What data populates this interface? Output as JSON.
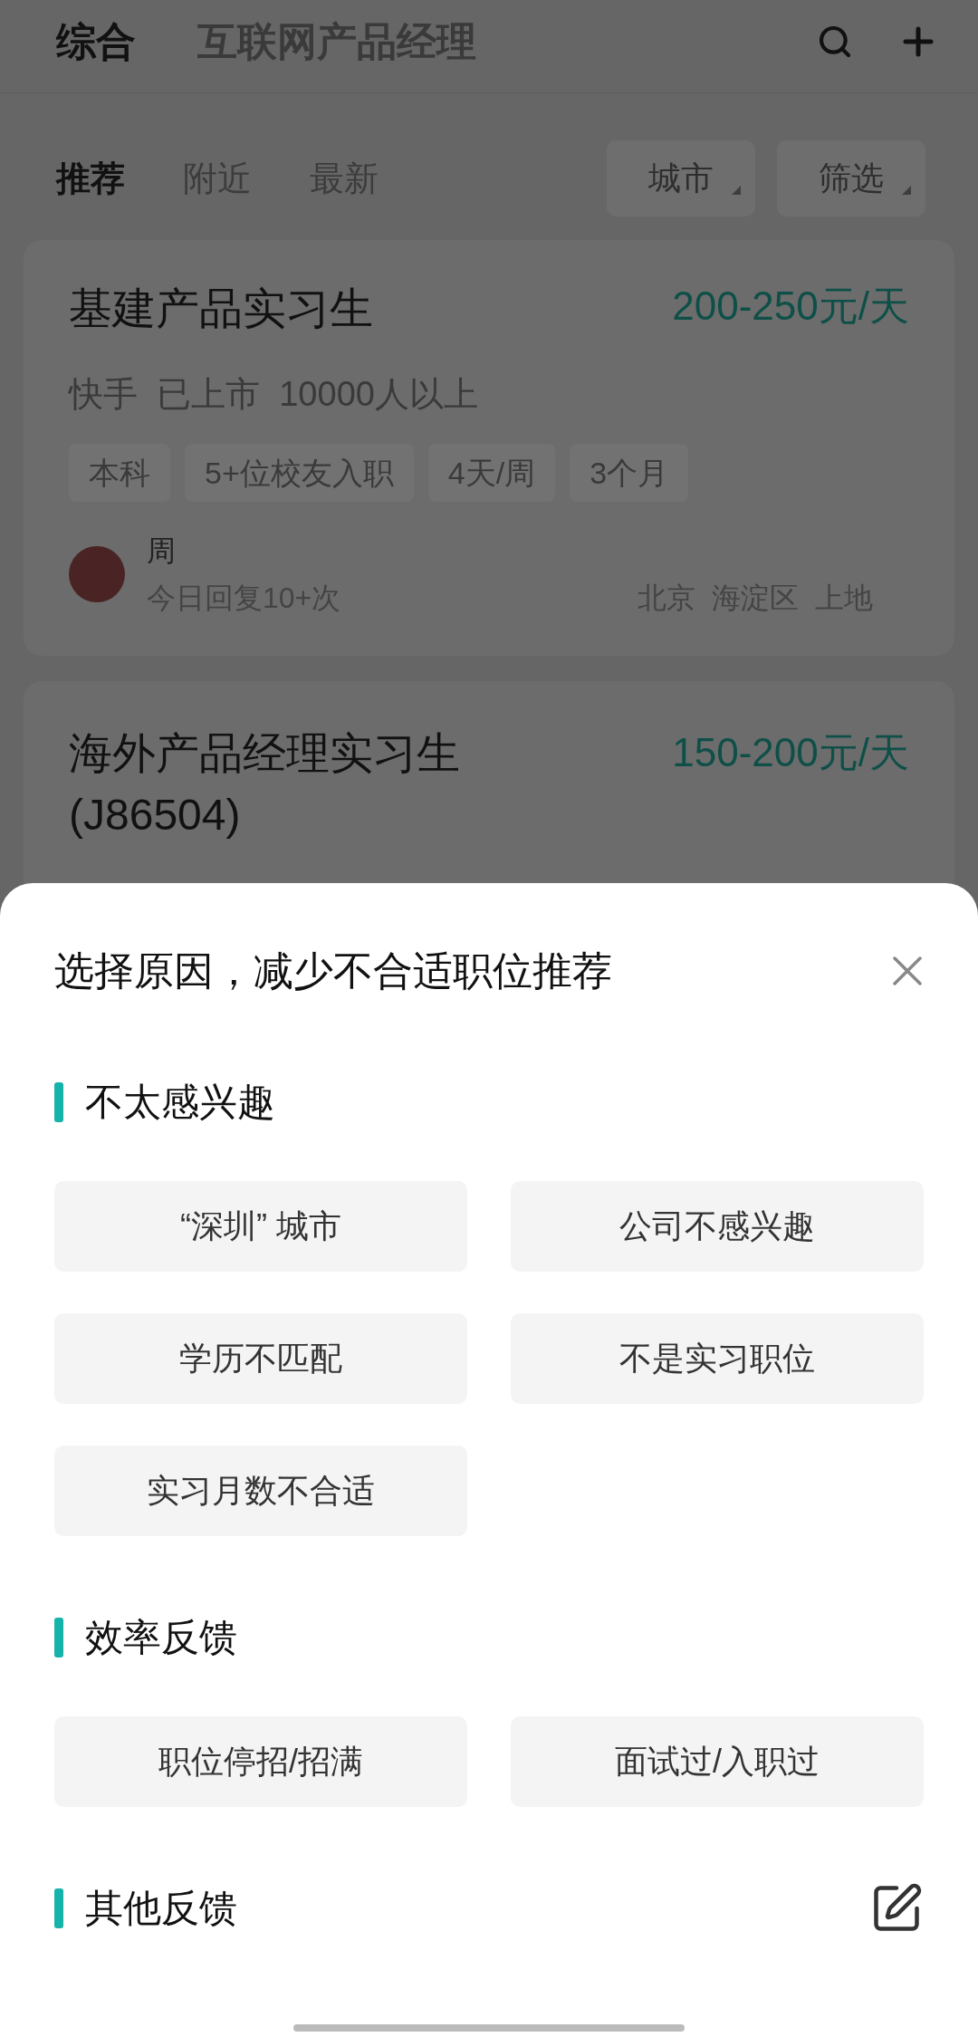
{
  "top_tabs": [
    {
      "label": "综合",
      "selected": true
    },
    {
      "label": "互联网产品经理",
      "selected": false
    }
  ],
  "sub_tabs": [
    {
      "label": "推荐",
      "selected": true
    },
    {
      "label": "附近",
      "selected": false
    },
    {
      "label": "最新",
      "selected": false
    }
  ],
  "filters": [
    "城市",
    "筛选"
  ],
  "jobs": [
    {
      "title": "基建产品实习生",
      "salary": "200-250元/天",
      "company": "快手  已上市  10000人以上",
      "tags": [
        "本科",
        "5+位校友入职",
        "4天/周",
        "3个月"
      ],
      "recruiter": "周",
      "reply": "今日回复10+次",
      "location": "北京  海淀区  上地"
    },
    {
      "title": "海外产品经理实习生 (J86504)",
      "salary": "150-200元/天"
    }
  ],
  "sheet": {
    "title": "选择原因，减少不合适职位推荐",
    "sections": [
      {
        "heading": "不太感兴趣",
        "options": [
          "“深圳” 城市",
          "公司不感兴趣",
          "学历不匹配",
          "不是实习职位",
          "实习月数不合适"
        ]
      },
      {
        "heading": "效率反馈",
        "options": [
          "职位停招/招满",
          "面试过/入职过"
        ]
      },
      {
        "heading": "其他反馈",
        "editable": true
      }
    ]
  }
}
